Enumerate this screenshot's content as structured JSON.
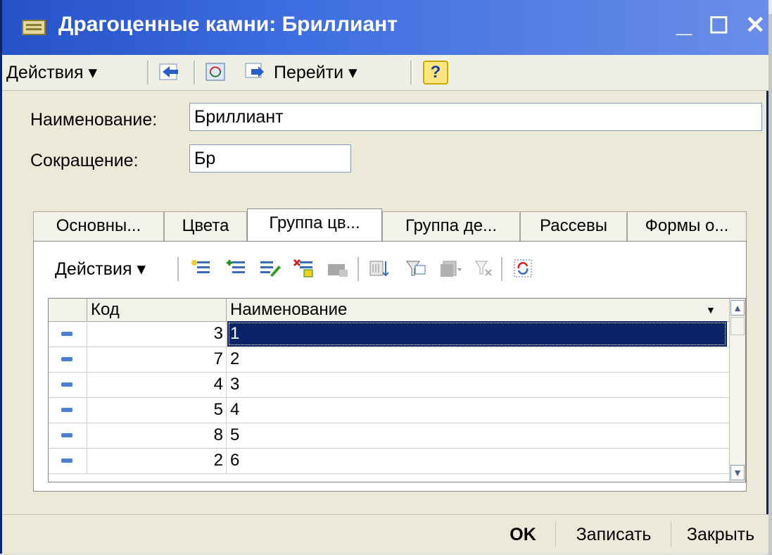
{
  "window": {
    "title": "Драгоценные камни: Бриллиант",
    "minimize": "_",
    "maximize": "☐",
    "close": "✕"
  },
  "toolbar": {
    "actions": "Действия ▾",
    "goto": "Перейти ▾",
    "help": "?"
  },
  "form": {
    "name_label": "Наименование:",
    "name_value": "Бриллиант",
    "abbr_label": "Сокращение:",
    "abbr_value": "Бр"
  },
  "tabs": [
    "Основны...",
    "Цвета",
    "Группа цв...",
    "Группа де...",
    "Рассевы",
    "Формы о..."
  ],
  "active_tab": 2,
  "subtoolbar": {
    "actions": "Действия ▾"
  },
  "table": {
    "headers": [
      "Код",
      "Наименование"
    ],
    "rows": [
      {
        "code": "3",
        "name": "1"
      },
      {
        "code": "7",
        "name": "2"
      },
      {
        "code": "4",
        "name": "3"
      },
      {
        "code": "5",
        "name": "4"
      },
      {
        "code": "8",
        "name": "5"
      },
      {
        "code": "2",
        "name": "6"
      }
    ],
    "selected_row": 0
  },
  "buttons": {
    "ok": "OK",
    "save": "Записать",
    "close": "Закрыть"
  },
  "colors": {
    "title_bar": "#2552c8",
    "selection": "#0a246a",
    "row_marker": "#4d7fd0"
  }
}
